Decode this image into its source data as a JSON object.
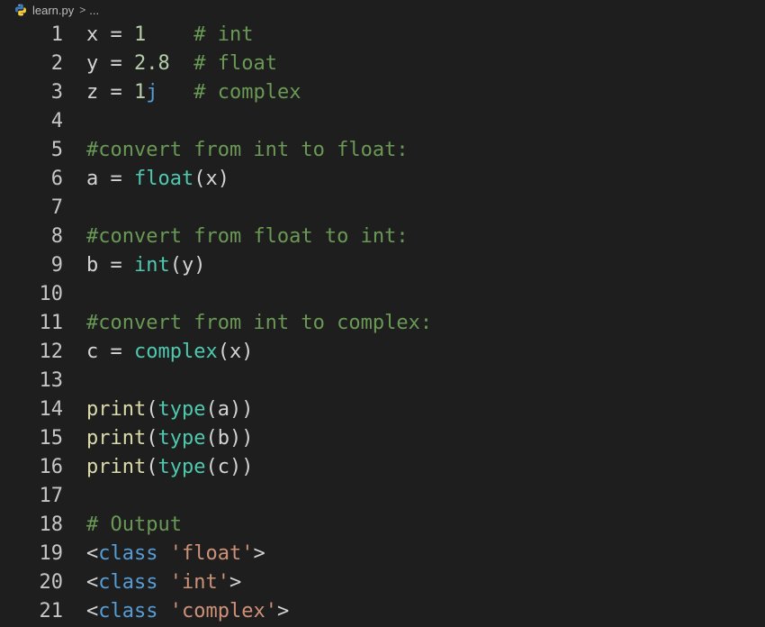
{
  "breadcrumb": {
    "file": "learn.py",
    "separator": ">",
    "more": "..."
  },
  "icons": {
    "python": "python-file-icon"
  },
  "colors": {
    "background": "#1e1e1e",
    "comment": "#6a9955",
    "number": "#b5cea8",
    "builtin": "#4ec9b0",
    "function": "#dcdcaa",
    "keyword": "#569cd6",
    "string": "#ce9178"
  },
  "lines": [
    {
      "n": "1",
      "tokens": [
        [
          "id",
          "x = "
        ],
        [
          "num",
          "1"
        ],
        [
          "id",
          "    "
        ],
        [
          "comment",
          "# int"
        ]
      ]
    },
    {
      "n": "2",
      "tokens": [
        [
          "id",
          "y = "
        ],
        [
          "num",
          "2.8"
        ],
        [
          "id",
          "  "
        ],
        [
          "comment",
          "# float"
        ]
      ]
    },
    {
      "n": "3",
      "tokens": [
        [
          "id",
          "z = "
        ],
        [
          "num",
          "1"
        ],
        [
          "j",
          "j"
        ],
        [
          "id",
          "   "
        ],
        [
          "comment",
          "# complex"
        ]
      ]
    },
    {
      "n": "4",
      "tokens": []
    },
    {
      "n": "5",
      "tokens": [
        [
          "comment",
          "#convert from int to float:"
        ]
      ]
    },
    {
      "n": "6",
      "tokens": [
        [
          "id",
          "a = "
        ],
        [
          "func",
          "float"
        ],
        [
          "id",
          "(x)"
        ]
      ]
    },
    {
      "n": "7",
      "tokens": []
    },
    {
      "n": "8",
      "tokens": [
        [
          "comment",
          "#convert from float to int:"
        ]
      ]
    },
    {
      "n": "9",
      "tokens": [
        [
          "id",
          "b = "
        ],
        [
          "func",
          "int"
        ],
        [
          "id",
          "(y)"
        ]
      ]
    },
    {
      "n": "10",
      "tokens": []
    },
    {
      "n": "11",
      "tokens": [
        [
          "comment",
          "#convert from int to complex:"
        ]
      ]
    },
    {
      "n": "12",
      "tokens": [
        [
          "id",
          "c = "
        ],
        [
          "func",
          "complex"
        ],
        [
          "id",
          "(x)"
        ]
      ]
    },
    {
      "n": "13",
      "tokens": []
    },
    {
      "n": "14",
      "tokens": [
        [
          "print",
          "print"
        ],
        [
          "id",
          "("
        ],
        [
          "func",
          "type"
        ],
        [
          "id",
          "(a))"
        ]
      ]
    },
    {
      "n": "15",
      "tokens": [
        [
          "print",
          "print"
        ],
        [
          "id",
          "("
        ],
        [
          "func",
          "type"
        ],
        [
          "id",
          "(b))"
        ]
      ]
    },
    {
      "n": "16",
      "tokens": [
        [
          "print",
          "print"
        ],
        [
          "id",
          "("
        ],
        [
          "func",
          "type"
        ],
        [
          "id",
          "(c))"
        ]
      ]
    },
    {
      "n": "17",
      "tokens": []
    },
    {
      "n": "18",
      "tokens": [
        [
          "comment",
          "# Output"
        ]
      ]
    },
    {
      "n": "19",
      "tokens": [
        [
          "id",
          "<"
        ],
        [
          "kw",
          "class"
        ],
        [
          "id",
          " "
        ],
        [
          "str",
          "'float'"
        ],
        [
          "id",
          ">"
        ]
      ]
    },
    {
      "n": "20",
      "tokens": [
        [
          "id",
          "<"
        ],
        [
          "kw",
          "class"
        ],
        [
          "id",
          " "
        ],
        [
          "str",
          "'int'"
        ],
        [
          "id",
          ">"
        ]
      ]
    },
    {
      "n": "21",
      "tokens": [
        [
          "id",
          "<"
        ],
        [
          "kw",
          "class"
        ],
        [
          "id",
          " "
        ],
        [
          "str",
          "'complex'"
        ],
        [
          "id",
          ">"
        ]
      ]
    }
  ]
}
